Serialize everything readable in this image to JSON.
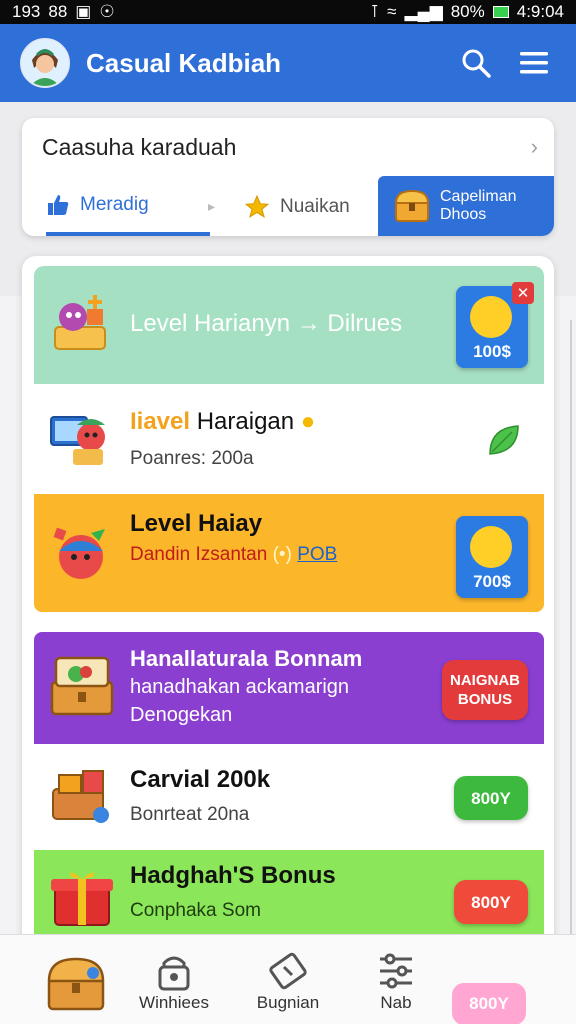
{
  "status_bar": {
    "left_text": "193",
    "left_glyph": "88",
    "battery": "80%",
    "time": "4:9:04"
  },
  "app_bar": {
    "title": "Casual Kadbiah"
  },
  "filter_card": {
    "title": "Caasuha karaduah",
    "tabs": [
      {
        "label": "Meradig"
      },
      {
        "label": "Nuaikan"
      },
      {
        "label_line1": "Capeliman",
        "label_line2": "Dhoos"
      }
    ]
  },
  "rows": [
    {
      "title": "Level Harianyn → Dilrues",
      "badge": "100$"
    },
    {
      "title_accent": "Iiavel",
      "title_rest": " Haraigan",
      "subtitle": "Poanres: 200a"
    },
    {
      "title": "Level Haiay",
      "subtitle": "Dandin Izsantan",
      "subtitle_symbol": "(•)",
      "subtitle_link": "POB",
      "badge": "700$"
    },
    {
      "title": "Hanallaturala Bonnam",
      "line2": "hanadhakan ackamarign",
      "line3": "Denogekan",
      "pill_line1": "NAIGNAB",
      "pill_line2": "BONUS"
    },
    {
      "title": "Carvial 200k",
      "subtitle": "Bonrteat 20na",
      "pill": "800Y"
    },
    {
      "title": "Hadghah'S Bonus",
      "subtitle": "Conphaka Som",
      "pill": "800Y"
    }
  ],
  "bottom_nav": {
    "items": [
      {
        "label": ""
      },
      {
        "label": "Winhiees"
      },
      {
        "label": "Bugnian"
      },
      {
        "label": "Nab"
      }
    ],
    "pill": "800Y"
  },
  "colors": {
    "primary": "#2f6fd8",
    "row_mint": "#a6e0c2",
    "row_orange": "#fcb62a",
    "row_purple": "#8a3fd1",
    "row_lime": "#8ce65a",
    "pill_red": "#e33b3b",
    "pill_green": "#3dba3d",
    "pill_pink": "#ffa6d2"
  }
}
